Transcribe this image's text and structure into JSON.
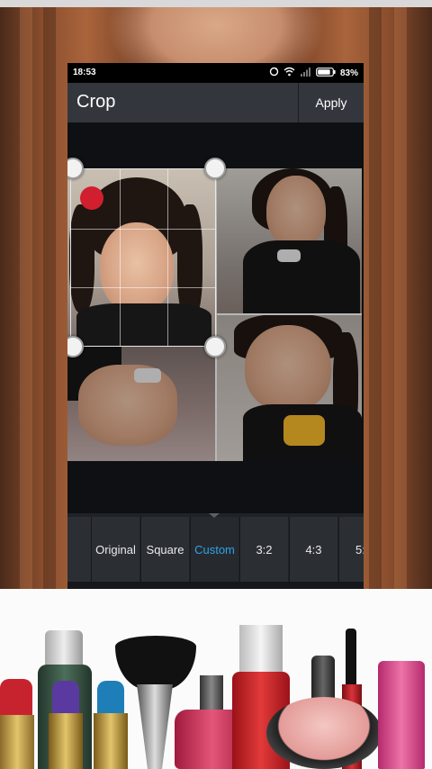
{
  "status_bar": {
    "time": "18:53",
    "battery": "83%"
  },
  "header": {
    "title": "Crop",
    "apply_label": "Apply"
  },
  "ratios": {
    "items": [
      {
        "label": ""
      },
      {
        "label": "Original"
      },
      {
        "label": "Square"
      },
      {
        "label": "Custom"
      },
      {
        "label": "3:2"
      },
      {
        "label": "4:3"
      },
      {
        "label": "5:"
      }
    ],
    "selected": "Custom"
  },
  "colors": {
    "accent": "#2ea2e6",
    "title_bar": "#33373d",
    "ratio_bar": "#1f2226",
    "canvas": "#0e1013"
  },
  "icons": [
    "sync-icon",
    "wifi-icon",
    "signal-icon",
    "battery-icon"
  ]
}
